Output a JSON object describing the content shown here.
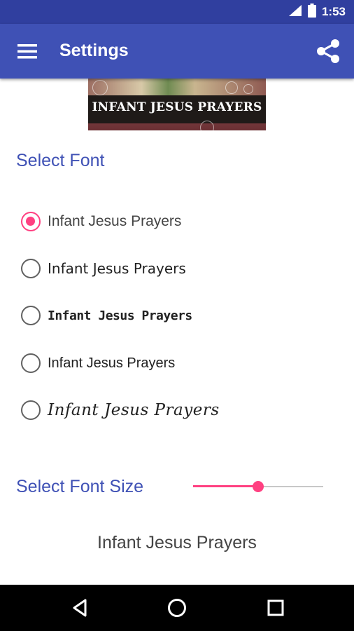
{
  "status_bar": {
    "time": "1:53",
    "icons": [
      "signal-icon",
      "battery-icon"
    ]
  },
  "app_bar": {
    "title": "Settings",
    "menu_icon": "menu-icon",
    "share_icon": "share-icon"
  },
  "banner": {
    "caption": "INFANT JESUS PRAYERS"
  },
  "font_section": {
    "title": "Select Font",
    "options": [
      {
        "label": "Infant Jesus Prayers",
        "selected": true
      },
      {
        "label": "Infant Jesus Prayers",
        "selected": false
      },
      {
        "label": "Infant Jesus Prayers",
        "selected": false
      },
      {
        "label": "Infant Jesus Prayers",
        "selected": false
      },
      {
        "label": "Infant Jesus Prayers",
        "selected": false
      }
    ]
  },
  "size_section": {
    "title": "Select Font Size",
    "slider_value": 0.5
  },
  "preview": {
    "text": "Infant Jesus Prayers"
  },
  "nav_bar": {
    "icons": [
      "back-icon",
      "home-icon",
      "recents-icon"
    ]
  },
  "colors": {
    "primary": "#3F51B5",
    "primary_dark": "#303F9F",
    "accent": "#FF4081"
  }
}
